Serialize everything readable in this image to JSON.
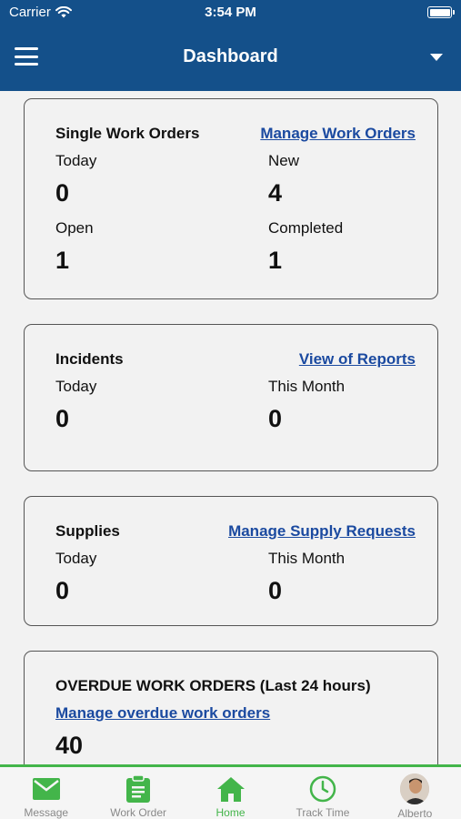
{
  "status_bar": {
    "carrier": "Carrier",
    "time": "3:54 PM"
  },
  "header": {
    "title": "Dashboard"
  },
  "cards": {
    "work_orders": {
      "title": "Single Work Orders",
      "link": "Manage Work Orders",
      "today_label": "Today",
      "today_value": "0",
      "new_label": "New",
      "new_value": "4",
      "open_label": "Open",
      "open_value": "1",
      "completed_label": "Completed",
      "completed_value": "1"
    },
    "incidents": {
      "title": "Incidents",
      "link": "View of Reports",
      "today_label": "Today",
      "today_value": "0",
      "month_label": "This Month",
      "month_value": "0"
    },
    "supplies": {
      "title": "Supplies",
      "link": "Manage Supply Requests",
      "today_label": "Today",
      "today_value": "0",
      "month_label": "This Month",
      "month_value": "0"
    },
    "overdue": {
      "title": "OVERDUE WORK ORDERS (Last 24 hours)",
      "link": "Manage overdue work orders",
      "value": "40"
    }
  },
  "tabbar": {
    "items": [
      {
        "label": "Message",
        "icon": "mail-icon"
      },
      {
        "label": "Work Order",
        "icon": "clipboard-icon"
      },
      {
        "label": "Home",
        "icon": "home-icon",
        "active": true
      },
      {
        "label": "Track Time",
        "icon": "clock-icon"
      },
      {
        "label": "Alberto",
        "icon": "avatar"
      }
    ]
  },
  "colors": {
    "header": "#14508a",
    "accent": "#43b54a",
    "link": "#1b4aa0"
  }
}
